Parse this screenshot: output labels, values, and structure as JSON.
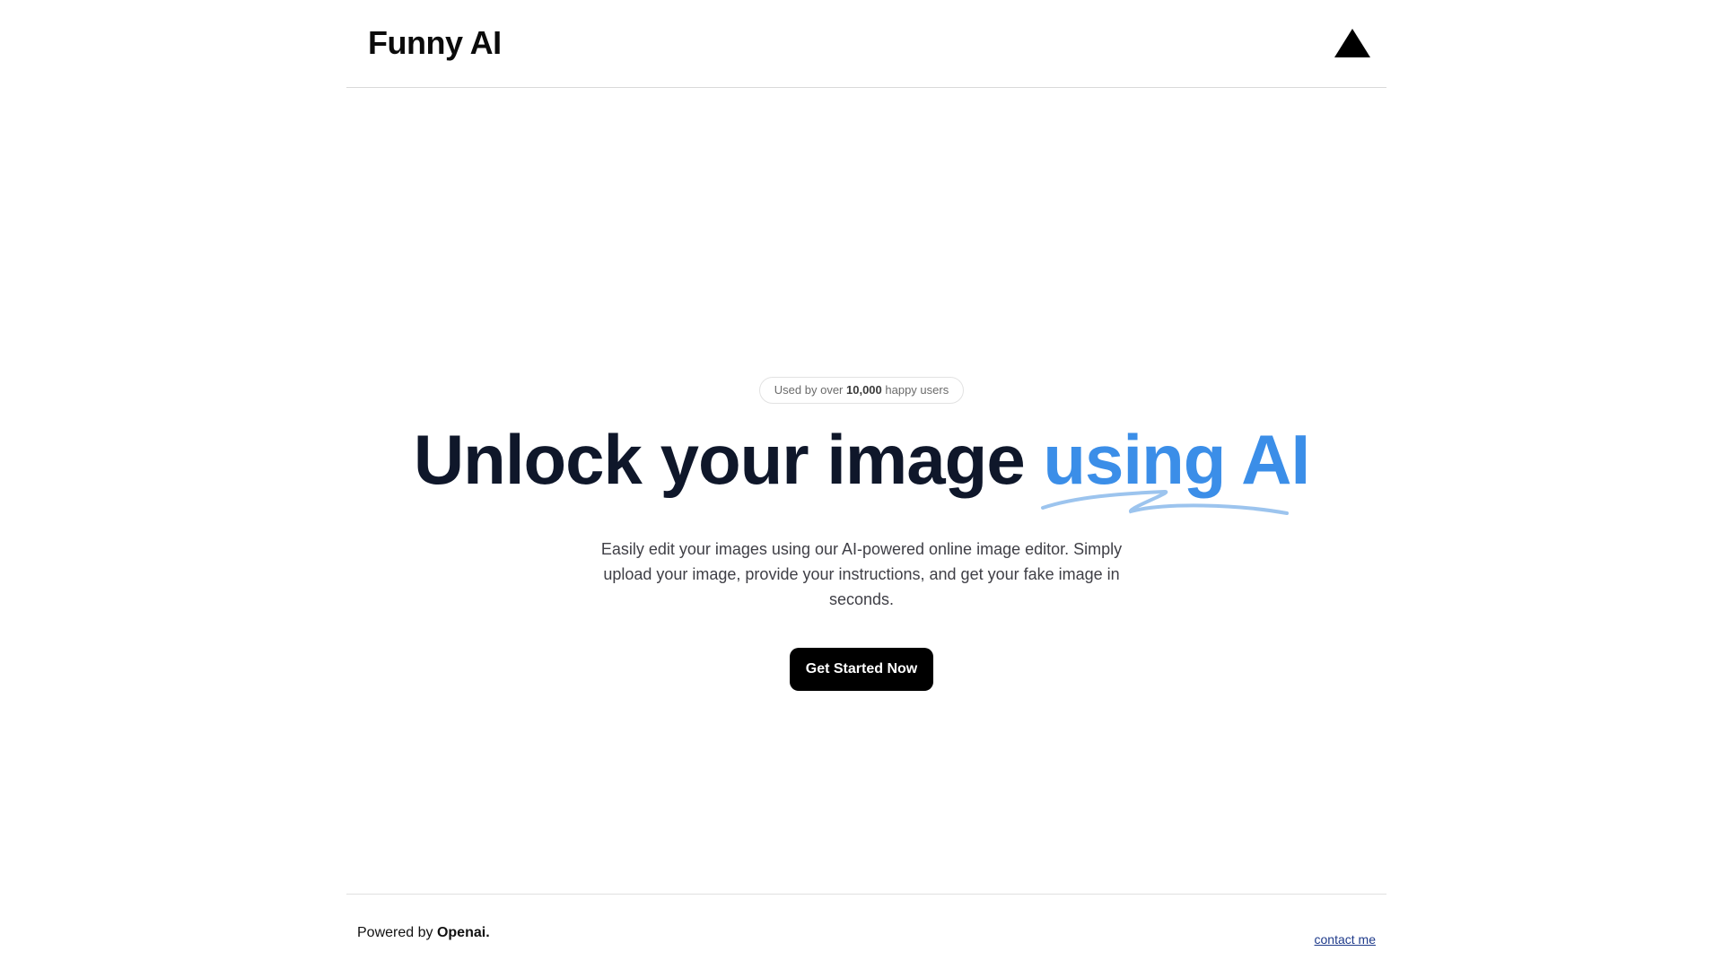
{
  "header": {
    "brand": "Funny AI",
    "vercel_icon": "triangle-logo-icon"
  },
  "hero": {
    "badge": {
      "prefix": "Used by over",
      "count": "10,000",
      "suffix": "happy users"
    },
    "headline": {
      "main": "Unlock your image",
      "accent": "using AI"
    },
    "description": "Easily edit your images using our AI-powered online image editor. Simply upload your image, provide your instructions, and get your fake image in seconds.",
    "cta_label": "Get Started Now"
  },
  "footer": {
    "powered_prefix": "Powered by",
    "powered_brand": "Openai.",
    "contact_label": "contact me"
  },
  "colors": {
    "accent": "#3b8ee8",
    "headline": "#0f172a",
    "button": "#000000",
    "squiggle": "#9cc4ee"
  }
}
